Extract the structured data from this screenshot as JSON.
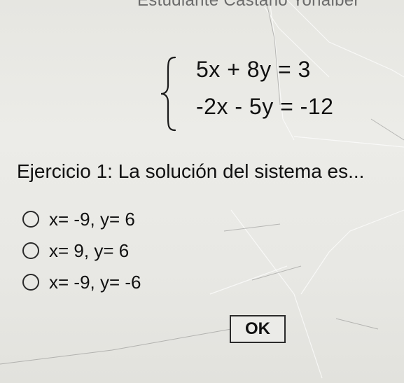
{
  "header": {
    "student_name": "Estudiante  Castaño Yonaiber"
  },
  "system": {
    "equation_1": "5x + 8y = 3",
    "equation_2": "-2x - 5y = -12"
  },
  "question": {
    "text": "Ejercicio 1: La solución del sistema es..."
  },
  "options": [
    {
      "label": "x= -9, y= 6"
    },
    {
      "label": "x= 9, y= 6"
    },
    {
      "label": "x= -9, y= -6"
    }
  ],
  "actions": {
    "ok_label": "OK"
  }
}
